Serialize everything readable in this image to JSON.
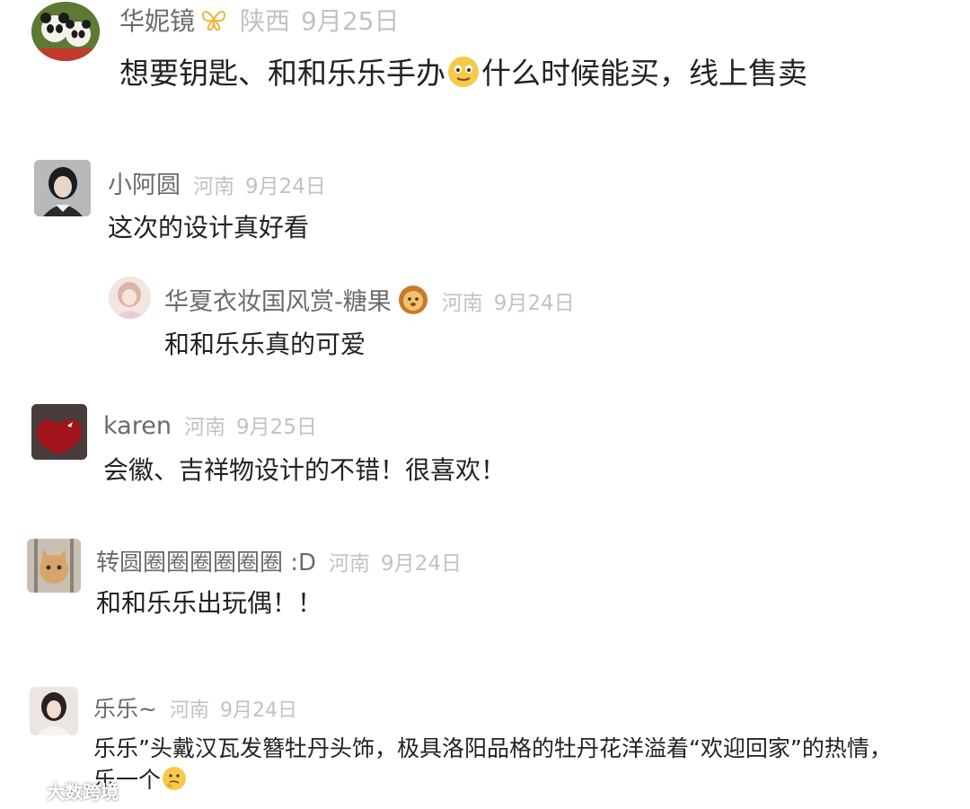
{
  "comments": [
    {
      "name": "华妮镜",
      "region": "陕西",
      "date": "9月25日",
      "text_a": "想要钥匙、和和乐乐手办",
      "text_b": "什么时候能买，线上售卖"
    },
    {
      "name": "小阿圆",
      "region": "河南",
      "date": "9月24日",
      "text": "这次的设计真好看"
    },
    {
      "name": "华夏衣妆国风赏-糖果",
      "region": "河南",
      "date": "9月24日",
      "text": "和和乐乐真的可爱"
    },
    {
      "name": "karen",
      "region": "河南",
      "date": "9月25日",
      "text": "会徽、吉祥物设计的不错！很喜欢！"
    },
    {
      "name": "转圆圈圈圈圈圈圈 :D",
      "region": "河南",
      "date": "9月24日",
      "text": "和和乐乐出玩偶！！"
    },
    {
      "name": "乐乐~",
      "region": "河南",
      "date": "9月24日",
      "text_line1": "乐乐”头戴汉瓦发簪牡丹头饰，极具洛阳品格的牡丹花洋溢着“欢迎回家”的热情，",
      "text_line2": "乐一个"
    }
  ],
  "watermark": "大数跨境"
}
